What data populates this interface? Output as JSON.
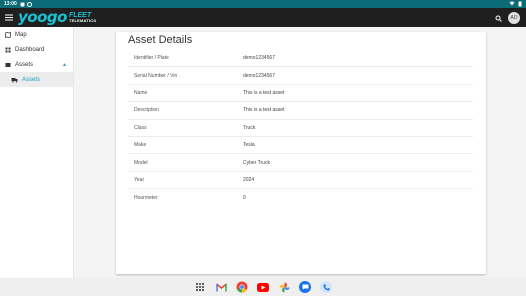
{
  "status_bar": {
    "time": "13:00"
  },
  "app": {
    "logo_main": "yoogo",
    "logo_fleet": "FLEET",
    "logo_telematics": "TELEMATICS",
    "avatar_initials": "AD"
  },
  "sidebar": {
    "items": [
      {
        "label": "Map",
        "icon": "map-icon"
      },
      {
        "label": "Dashboard",
        "icon": "dashboard-icon"
      },
      {
        "label": "Assets",
        "icon": "assets-icon",
        "expanded": true
      },
      {
        "label": "Assets",
        "icon": "truck-icon",
        "active": true
      }
    ]
  },
  "page": {
    "title": "Asset Details",
    "details": [
      {
        "label": "Identifier / Plate",
        "value": "demo1234567"
      },
      {
        "label": "Serial Number / Vin",
        "value": "demo1234567"
      },
      {
        "label": "Name",
        "value": "This is a test asset"
      },
      {
        "label": "Description",
        "value": "This is a test asset"
      },
      {
        "label": "Class",
        "value": "Truck"
      },
      {
        "label": "Make",
        "value": "Tesla"
      },
      {
        "label": "Model",
        "value": "Cyber Truck"
      },
      {
        "label": "Year",
        "value": "2024"
      },
      {
        "label": "Hourmeter",
        "value": "0"
      }
    ]
  },
  "dock": {
    "apps": [
      "apps-grid-icon",
      "gmail-icon",
      "chrome-icon",
      "youtube-icon",
      "photos-icon",
      "messages-icon",
      "phone-icon"
    ]
  },
  "colors": {
    "status_bar": "#0b6c78",
    "app_bar": "#1f1f1f",
    "accent": "#18c0d0",
    "active_nav": "#18a2b8"
  }
}
